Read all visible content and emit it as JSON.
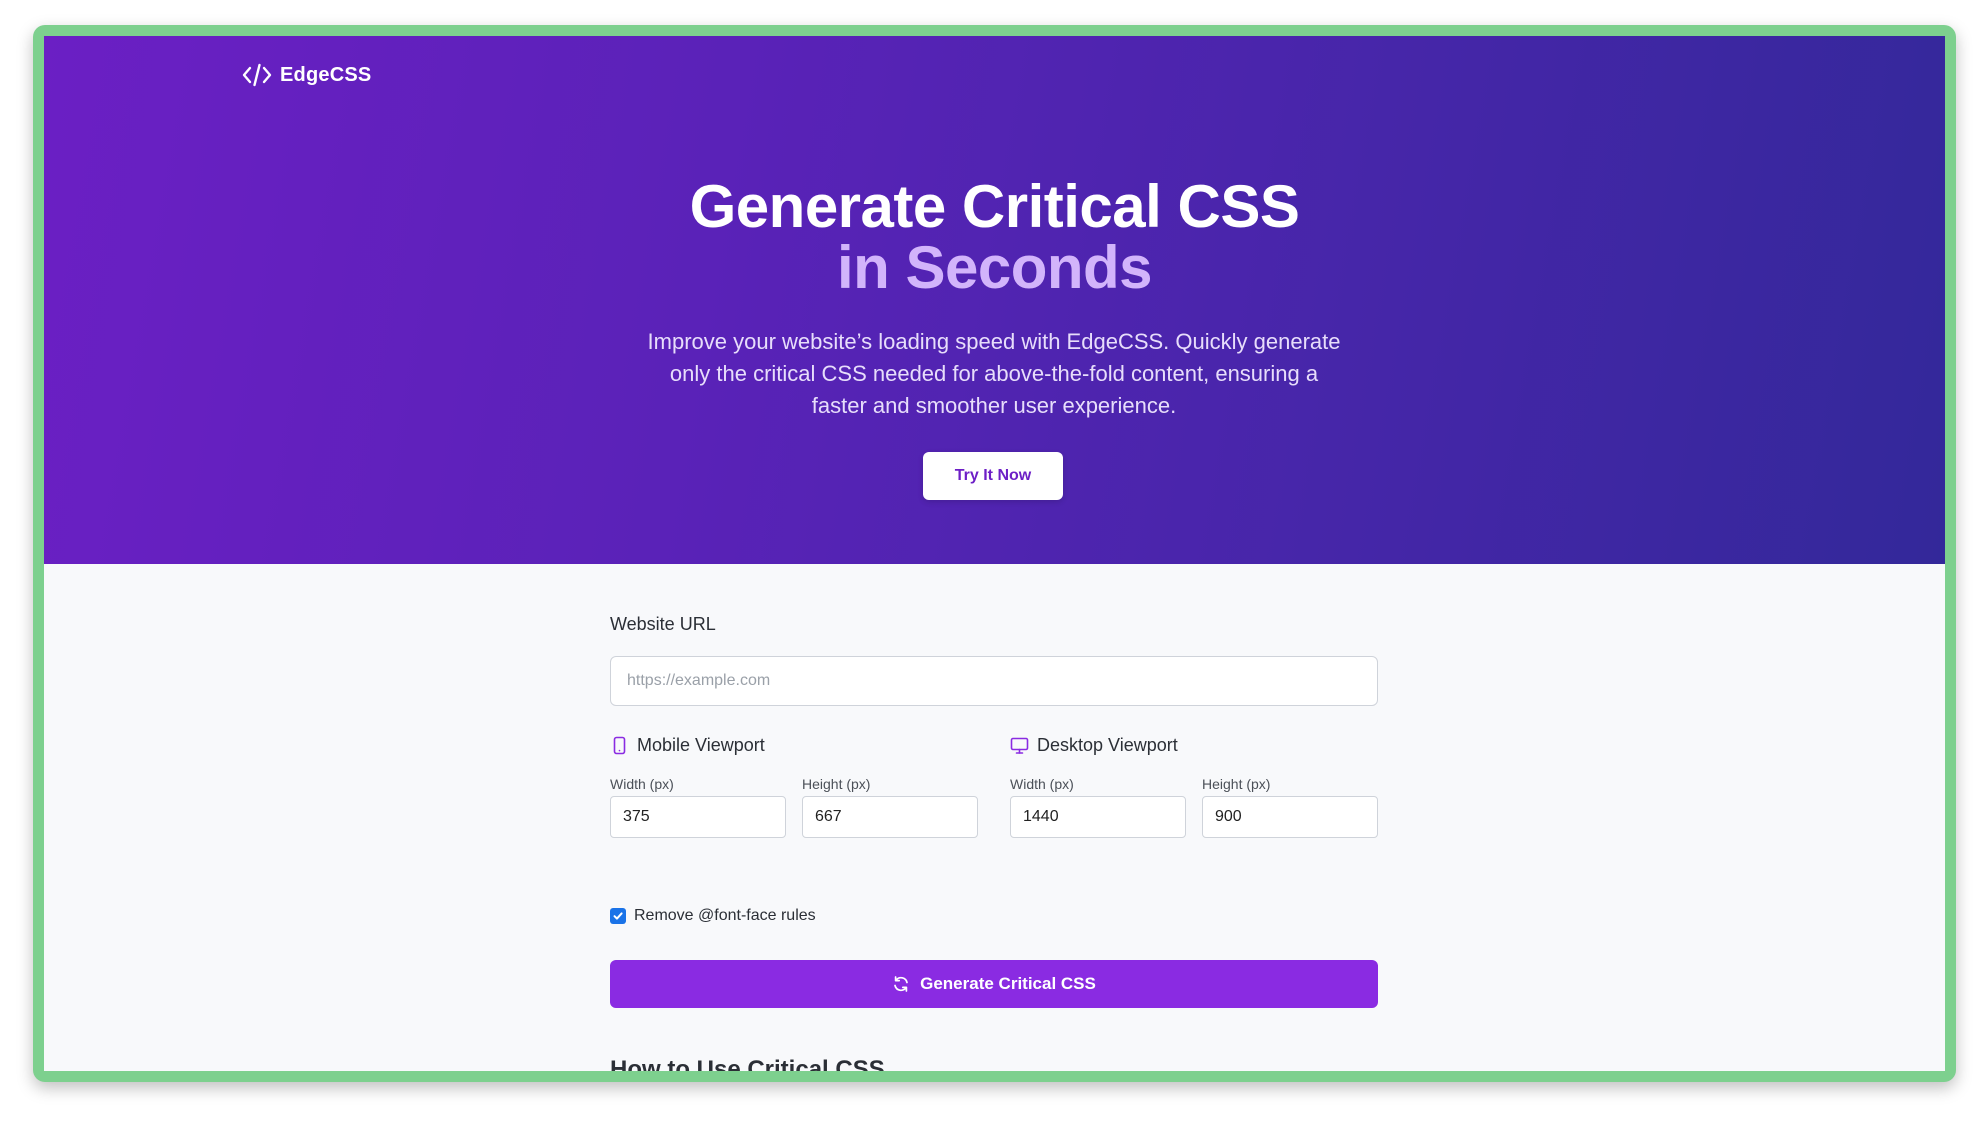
{
  "brand": {
    "name": "EdgeCSS",
    "logo_icon": "code-icon"
  },
  "hero": {
    "title_line1": "Generate Critical CSS",
    "title_line2": "in Seconds",
    "description": "Improve your website’s loading speed with EdgeCSS. Quickly generate only the critical CSS needed for above-the-fold content, ensuring a faster and smoother user experience.",
    "cta_label": "Try It Now"
  },
  "form": {
    "url_label": "Website URL",
    "url_placeholder": "https://example.com",
    "url_value": "",
    "mobile": {
      "heading": "Mobile Viewport",
      "icon": "mobile-icon",
      "width_label": "Width (px)",
      "width_value": "375",
      "height_label": "Height (px)",
      "height_value": "667"
    },
    "desktop": {
      "heading": "Desktop Viewport",
      "icon": "monitor-icon",
      "width_label": "Width (px)",
      "width_value": "1440",
      "height_label": "Height (px)",
      "height_value": "900"
    },
    "remove_fontface_label": "Remove @font-face rules",
    "remove_fontface_checked": true,
    "generate_label": "Generate Critical CSS",
    "generate_icon": "refresh-icon"
  },
  "section": {
    "how_to_title": "How to Use Critical CSS"
  },
  "colors": {
    "hero_start": "#6b1fc4",
    "hero_end": "#33289a",
    "accent_text": "#d2b4fb",
    "primary_button": "#8a2be2",
    "checkbox": "#1a73e8",
    "frame": "#7dd08e"
  }
}
